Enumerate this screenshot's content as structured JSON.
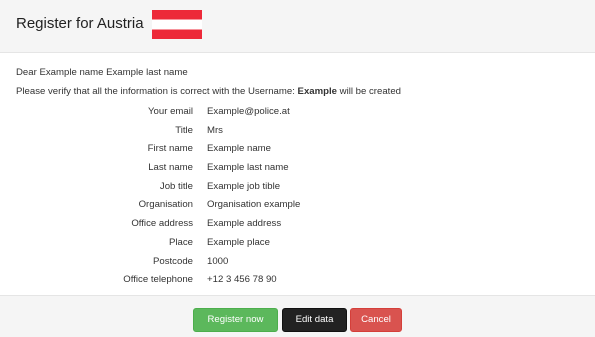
{
  "header": {
    "title": "Register for Austria",
    "flag": "austria-flag"
  },
  "message": {
    "greeting": "Dear Example name Example last name",
    "verify_prefix": "Please verify that all the information is correct with the Username: ",
    "username": "Example",
    "verify_suffix": " will be created"
  },
  "details": [
    {
      "label": "Your email",
      "value": "Example@police.at"
    },
    {
      "label": "Title",
      "value": "Mrs"
    },
    {
      "label": "First name",
      "value": "Example name"
    },
    {
      "label": "Last name",
      "value": "Example last name"
    },
    {
      "label": "Job title",
      "value": "Example job tible"
    },
    {
      "label": "Organisation",
      "value": "Organisation example"
    },
    {
      "label": "Office address",
      "value": "Example address"
    },
    {
      "label": "Place",
      "value": "Example place"
    },
    {
      "label": "Postcode",
      "value": "1000"
    },
    {
      "label": "Office telephone",
      "value": "+12 3 456 78 90"
    }
  ],
  "buttons": {
    "register": "Register now",
    "edit": "Edit data",
    "cancel": "Cancel"
  },
  "colors": {
    "register": "#5cb85c",
    "edit": "#222222",
    "cancel": "#d9534f",
    "flag_red": "#ed2939"
  }
}
